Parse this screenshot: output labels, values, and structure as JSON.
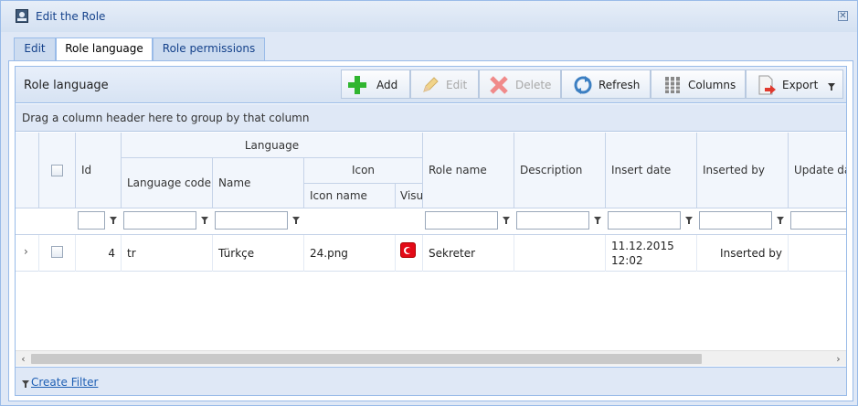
{
  "window": {
    "title": "Edit the Role"
  },
  "tabs": [
    {
      "label": "Edit"
    },
    {
      "label": "Role language"
    },
    {
      "label": "Role permissions"
    }
  ],
  "grid": {
    "title": "Role language",
    "toolbar": {
      "add": "Add",
      "edit": "Edit",
      "delete": "Delete",
      "refresh": "Refresh",
      "columns": "Columns",
      "export": "Export"
    },
    "group_hint": "Drag a column header here to group by that column",
    "headers": {
      "id": "Id",
      "language": "Language",
      "language_code": "Language code",
      "name": "Name",
      "icon": "Icon",
      "icon_name": "Icon name",
      "visual": "Visu",
      "role_name": "Role name",
      "description": "Description",
      "insert_date": "Insert date",
      "inserted_by": "Inserted by",
      "update_date": "Update da"
    },
    "rows": [
      {
        "id": "4",
        "language_code": "tr",
        "name": "Türkçe",
        "icon_name": "24.png",
        "role_name": "Sekreter",
        "description": "",
        "insert_date_line1": "11.12.2015",
        "insert_date_line2": "12:02",
        "inserted_by": "Inserted by"
      }
    ],
    "footer": {
      "create_filter": "Create Filter"
    }
  }
}
